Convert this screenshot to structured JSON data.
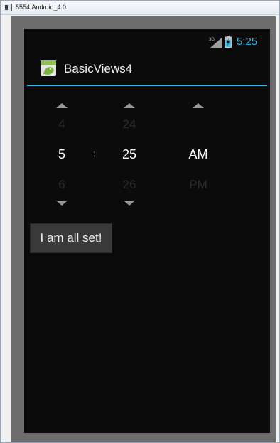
{
  "window": {
    "title": "5554:Android_4.0"
  },
  "status_bar": {
    "network": "3G",
    "time": "5:25"
  },
  "action_bar": {
    "title": "BasicViews4"
  },
  "time_picker": {
    "hour": {
      "prev": "4",
      "current": "5",
      "next": "6"
    },
    "separator": ":",
    "minute": {
      "prev": "24",
      "current": "25",
      "next": "26"
    },
    "ampm": {
      "prev": "",
      "current": "AM",
      "next": "PM"
    }
  },
  "button": {
    "label": "I am all set!"
  },
  "colors": {
    "accent": "#33b5e5",
    "screen_bg": "#0b0b0b",
    "button_bg": "#3a3a3a"
  }
}
